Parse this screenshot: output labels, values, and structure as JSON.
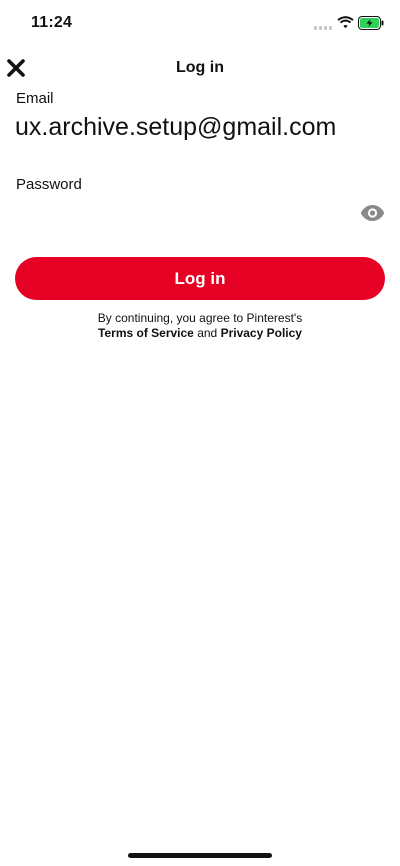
{
  "status_bar": {
    "time": "11:24",
    "battery_color": "#30d158"
  },
  "nav": {
    "title": "Log in",
    "close_icon": "close-icon"
  },
  "form": {
    "email_label": "Email",
    "email_value": "ux.archive.setup@gmail.com",
    "password_label": "Password",
    "password_value": "",
    "password_visibility_icon": "eye-icon"
  },
  "login_button": {
    "label": "Log in",
    "color": "#e60023"
  },
  "legal": {
    "prefix": "By continuing, you agree to Pinterest's",
    "terms": "Terms of Service",
    "connector": "and",
    "privacy": "Privacy Policy"
  }
}
